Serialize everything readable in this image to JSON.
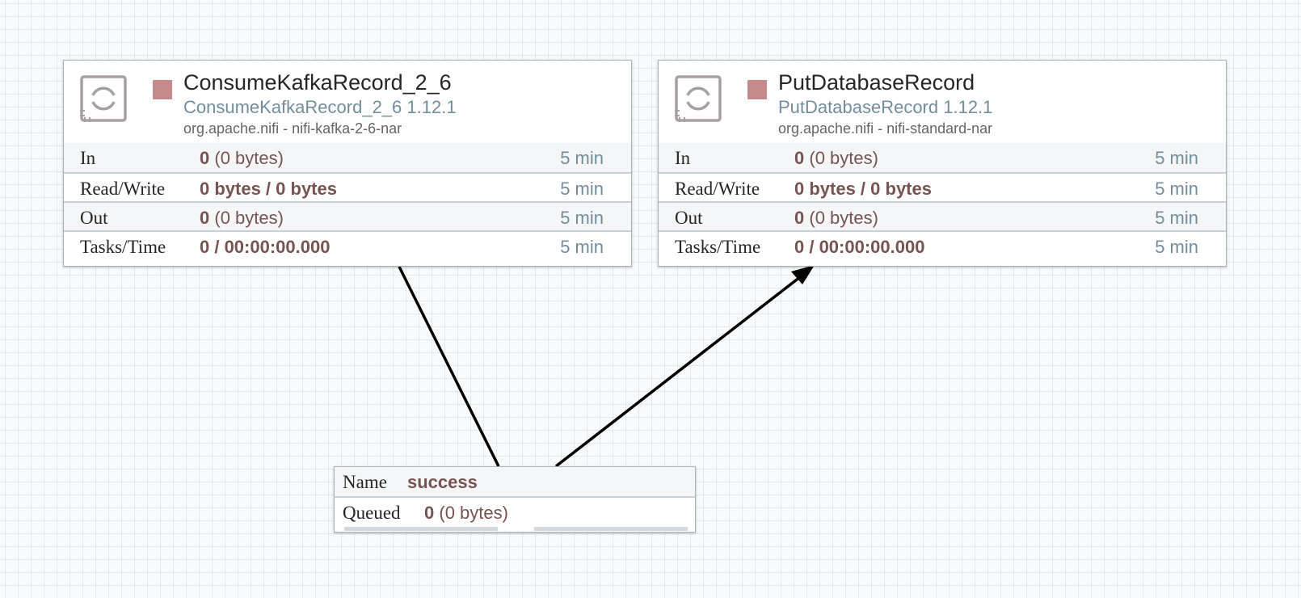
{
  "processors": [
    {
      "name": "ConsumeKafkaRecord_2_6",
      "type": "ConsumeKafkaRecord_2_6 1.12.1",
      "bundle": "org.apache.nifi - nifi-kafka-2-6-nar",
      "stats": {
        "in": {
          "label": "In",
          "count": "0",
          "size": "(0 bytes)",
          "time": "5 min"
        },
        "read_write": {
          "label": "Read/Write",
          "value": "0 bytes / 0 bytes",
          "time": "5 min"
        },
        "out": {
          "label": "Out",
          "count": "0",
          "size": "(0 bytes)",
          "time": "5 min"
        },
        "tasks_time": {
          "label": "Tasks/Time",
          "value": "0 / 00:00:00.000",
          "time": "5 min"
        }
      }
    },
    {
      "name": "PutDatabaseRecord",
      "type": "PutDatabaseRecord 1.12.1",
      "bundle": "org.apache.nifi - nifi-standard-nar",
      "stats": {
        "in": {
          "label": "In",
          "count": "0",
          "size": "(0 bytes)",
          "time": "5 min"
        },
        "read_write": {
          "label": "Read/Write",
          "value": "0 bytes / 0 bytes",
          "time": "5 min"
        },
        "out": {
          "label": "Out",
          "count": "0",
          "size": "(0 bytes)",
          "time": "5 min"
        },
        "tasks_time": {
          "label": "Tasks/Time",
          "value": "0 / 00:00:00.000",
          "time": "5 min"
        }
      }
    }
  ],
  "connection": {
    "name_label": "Name",
    "name": "success",
    "queued_label": "Queued",
    "queued_count": "0",
    "queued_size": "(0 bytes)"
  },
  "icons": {
    "processor": "processor-icon",
    "run_status": "stopped-status-icon"
  },
  "colors": {
    "canvas_bg": "#f9fafb",
    "grid_line": "#e3e8eb",
    "stopped_status": "#c78a8a",
    "value_text": "#775351",
    "secondary_text": "#728e9b",
    "connection_line": "#000000"
  }
}
